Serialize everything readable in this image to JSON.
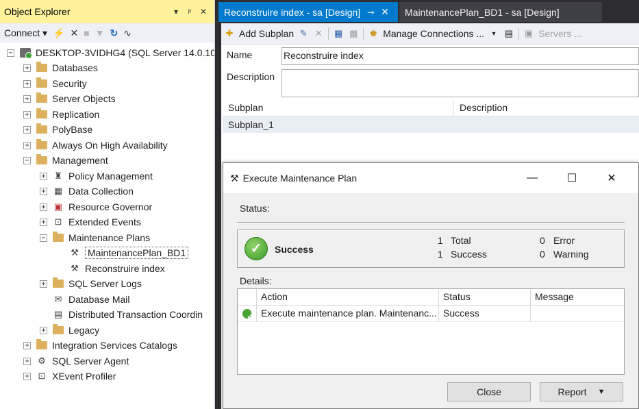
{
  "object_explorer": {
    "title": "Object Explorer",
    "pin_glyph": "▾ 📌 ✕",
    "connect_label": "Connect ▾",
    "tree": {
      "server": "DESKTOP-3VIDHG4 (SQL Server 14.0.10",
      "databases": "Databases",
      "security": "Security",
      "server_objects": "Server Objects",
      "replication": "Replication",
      "polybase": "PolyBase",
      "always_on": "Always On High Availability",
      "management": "Management",
      "policy_management": "Policy Management",
      "data_collection": "Data Collection",
      "resource_governor": "Resource Governor",
      "extended_events": "Extended Events",
      "maintenance_plans": "Maintenance Plans",
      "plan1": "MaintenancePlan_BD1",
      "plan2": "Reconstruire index",
      "sql_server_logs": "SQL Server Logs",
      "database_mail": "Database Mail",
      "dtc": "Distributed Transaction Coordin",
      "legacy": "Legacy",
      "isc": "Integration Services Catalogs",
      "agent": "SQL Server Agent",
      "xevent": "XEvent Profiler"
    }
  },
  "tabs": {
    "active": "Reconstruire index - sa [Design]",
    "inactive": "MaintenancePlan_BD1 - sa [Design]"
  },
  "design": {
    "toolbar": {
      "add_subplan": "Add Subplan",
      "manage_connections": "Manage Connections ...",
      "servers": "Servers ..."
    },
    "name_label": "Name",
    "name_value": "Reconstruire index",
    "description_label": "Description",
    "description_value": "",
    "grid": {
      "headers": [
        "Subplan",
        "Description"
      ],
      "rows": [
        [
          "Subplan_1",
          ""
        ]
      ]
    }
  },
  "dialog": {
    "title": "Execute Maintenance Plan",
    "status_label": "Status:",
    "result": "Success",
    "total_count": "1",
    "total_label": "Total",
    "success_count": "1",
    "success_label": "Success",
    "error_count": "0",
    "error_label": "Error",
    "warning_count": "0",
    "warning_label": "Warning",
    "details_label": "Details:",
    "columns": [
      "Action",
      "Status",
      "Message"
    ],
    "rows": [
      {
        "action": "Execute maintenance plan. Maintenanc...",
        "status": "Success",
        "message": ""
      }
    ],
    "close_button": "Close",
    "report_button": "Report"
  },
  "colors": {
    "active_tab": "#007acc",
    "oe_title": "#fff29d",
    "success_green": "#3c9a27"
  }
}
